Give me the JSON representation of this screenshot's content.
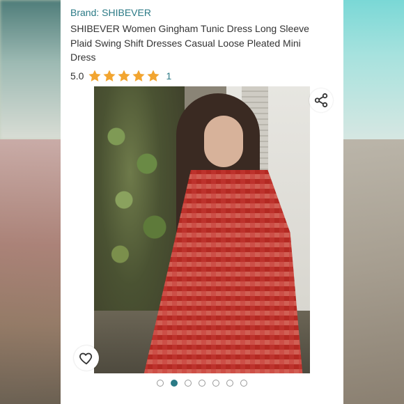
{
  "product": {
    "brand": "Brand: SHIBEVER",
    "title": "SHIBEVER Women Gingham Tunic Dress Long Sleeve Plaid Swing Shift Dresses Casual Loose Pleated Mini Dress",
    "rating_value": "5.0",
    "rating_stars": 5,
    "rating_max": 5,
    "rating_count": "1"
  },
  "gallery": {
    "image_count": 7,
    "active_index": 1,
    "icons": {
      "share": "share-icon",
      "wishlist": "heart-icon"
    }
  },
  "colors": {
    "accent": "#2b7a86",
    "star": "#f2a530",
    "text": "#333333"
  }
}
